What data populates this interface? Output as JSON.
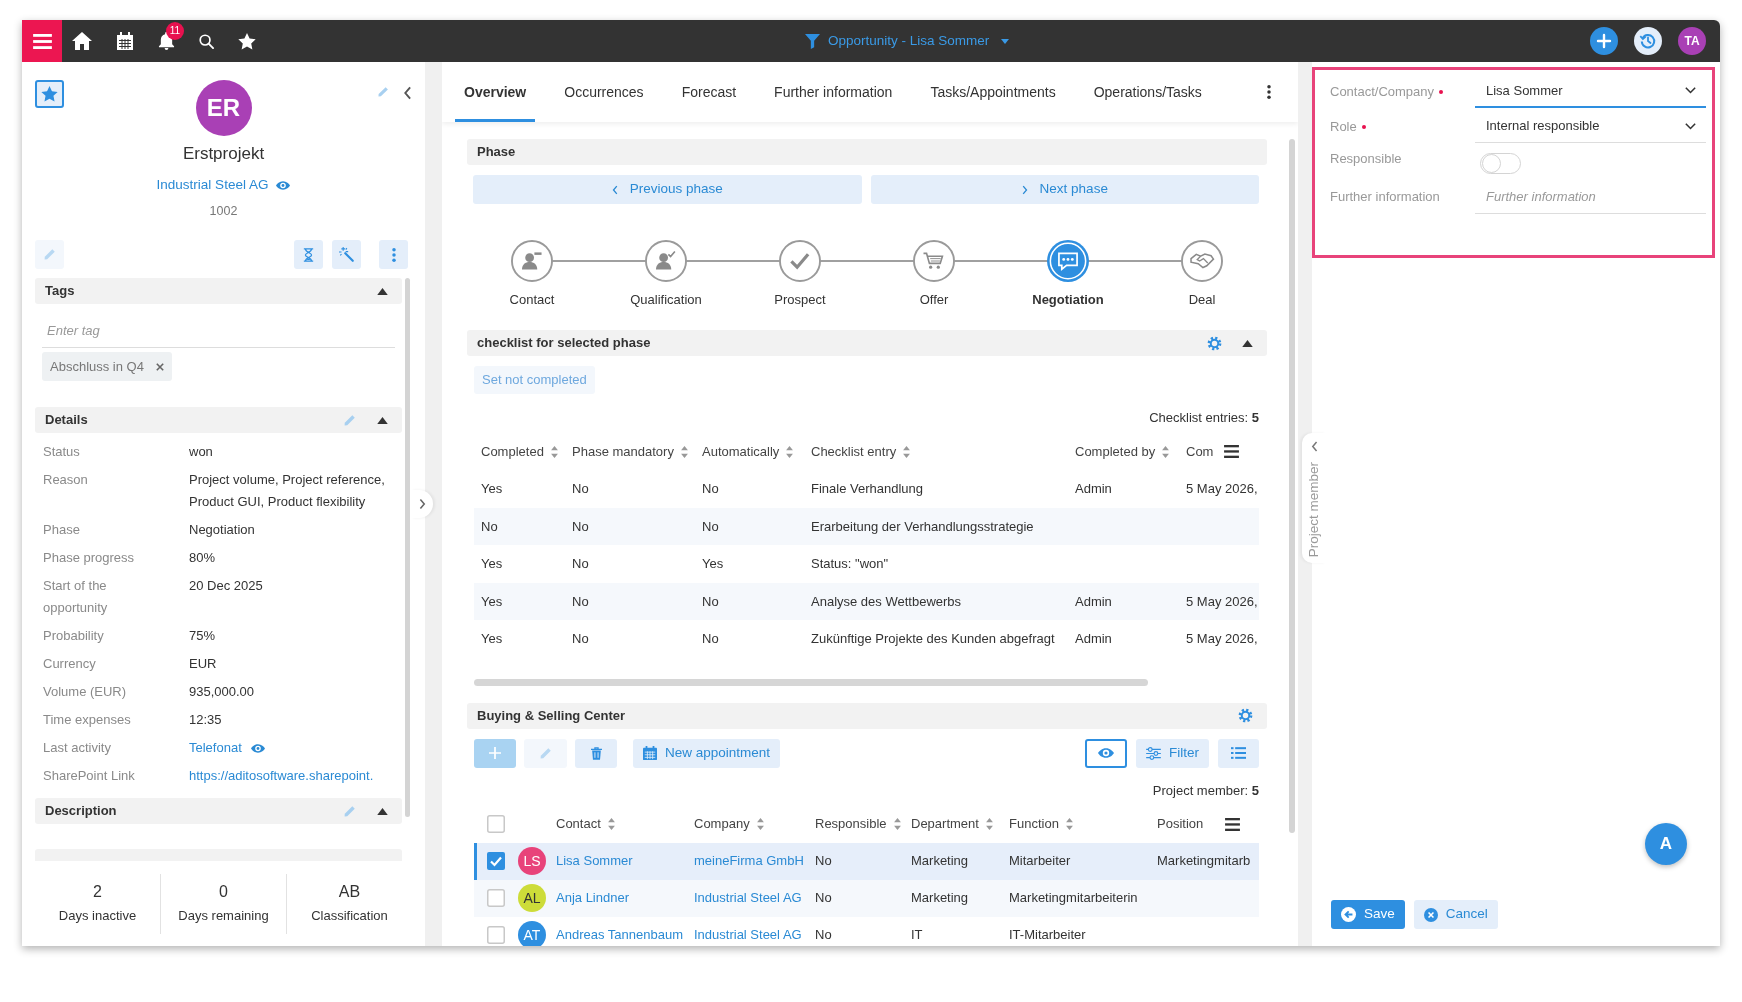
{
  "top_bar": {
    "notification_count": "11",
    "title": "Opportunity - Lisa Sommer",
    "user_initials": "TA"
  },
  "record": {
    "favorite": true,
    "initials": "ER",
    "name": "Erstprojekt",
    "company": "Industrial Steel AG",
    "number": "1002"
  },
  "tags": {
    "title": "Tags",
    "expanded": true,
    "placeholder": "Enter tag",
    "items": [
      "Abschluss in Q4"
    ]
  },
  "details": {
    "title": "Details",
    "expanded": true,
    "editable": true,
    "fields": [
      {
        "kind": "text",
        "label": "Status",
        "value": "won"
      },
      {
        "kind": "text",
        "label": "Reason",
        "value": "Project volume, Project reference, Product GUI, Product flexibility"
      },
      {
        "kind": "text",
        "label": "Phase",
        "value": "Negotiation"
      },
      {
        "kind": "text",
        "label": "Phase progress",
        "value": "80%"
      },
      {
        "kind": "text",
        "label": "Start of the opportunity",
        "value": "20 Dec 2025"
      },
      {
        "kind": "text",
        "label": "Probability",
        "value": "75%"
      },
      {
        "kind": "text",
        "label": "Currency",
        "value": "EUR"
      },
      {
        "kind": "text",
        "label": "Volume (EUR)",
        "value": "935,000.00"
      },
      {
        "kind": "text",
        "label": "Time expenses",
        "value": "12:35"
      },
      {
        "kind": "preview_link",
        "label": "Last activity",
        "value": "Telefonat"
      },
      {
        "kind": "link",
        "label": "SharePoint Link",
        "value": "https://aditosoftware.sharepoint."
      }
    ]
  },
  "description": {
    "title": "Description",
    "expanded": true,
    "editable": true
  },
  "stats": [
    {
      "value": "2",
      "label": "Days inactive"
    },
    {
      "value": "0",
      "label": "Days remaining"
    },
    {
      "value": "AB",
      "label": "Classification"
    }
  ],
  "tabs": [
    {
      "label": "Overview",
      "selected": true
    },
    {
      "label": "Occurrences",
      "selected": false
    },
    {
      "label": "Forecast",
      "selected": false
    },
    {
      "label": "Further information",
      "selected": false
    },
    {
      "label": "Tasks/Appointments",
      "selected": false
    },
    {
      "label": "Operations/Tasks",
      "selected": false
    }
  ],
  "phase": {
    "title": "Phase",
    "previous": "Previous phase",
    "next": "Next phase",
    "steps": [
      {
        "label": "Contact",
        "selected": false
      },
      {
        "label": "Qualification",
        "selected": false
      },
      {
        "label": "Prospect",
        "selected": false
      },
      {
        "label": "Offer",
        "selected": false
      },
      {
        "label": "Negotiation",
        "selected": true
      },
      {
        "label": "Deal",
        "selected": false
      }
    ]
  },
  "checklist": {
    "title": "checklist for selected phase",
    "expanded": true,
    "button": {
      "label": "Set not completed",
      "disabled": true
    },
    "count": "Checklist entries: **5**",
    "columns": [
      {
        "label": "Completed",
        "sortable": true
      },
      {
        "label": "Phase mandatory",
        "sortable": true
      },
      {
        "label": "Automatically",
        "sortable": true
      },
      {
        "label": "Checklist entry",
        "sortable": true
      },
      {
        "label": "Completed by",
        "sortable": true
      },
      {
        "label": "Com",
        "sortable": false
      }
    ],
    "rows": [
      {
        "completed": "Yes",
        "phase_mandatory": "No",
        "automatically": "No",
        "checklist_entry": "Finale Verhandlung",
        "completed_by": "Admin",
        "column_6": "5 May 2026,"
      },
      {
        "completed": "No",
        "phase_mandatory": "No",
        "automatically": "No",
        "checklist_entry": "Erarbeitung der Verhandlungsstrategie"
      },
      {
        "completed": "Yes",
        "phase_mandatory": "No",
        "automatically": "Yes",
        "checklist_entry": "Status: \"won\""
      },
      {
        "completed": "Yes",
        "phase_mandatory": "No",
        "automatically": "No",
        "checklist_entry": "Analyse des Wettbewerbs",
        "completed_by": "Admin",
        "column_6": "5 May 2026,"
      },
      {
        "completed": "Yes",
        "phase_mandatory": "No",
        "automatically": "No",
        "checklist_entry": "Zukünftige Projekte des Kunden abgefragt",
        "completed_by": "Admin",
        "column_6": "5 May 2026,"
      }
    ]
  },
  "buying_center": {
    "title": "Buying & Selling Center",
    "actions": [
      {
        "kind": "add",
        "disabled": true
      },
      {
        "kind": "edit",
        "disabled": true
      },
      {
        "kind": "delete",
        "disabled": false
      },
      {
        "kind": "appointment",
        "label": "New appointment",
        "disabled": false
      }
    ],
    "view_actions": [
      {
        "kind": "preview",
        "on": true
      },
      {
        "kind": "filter",
        "label": "Filter"
      },
      {
        "kind": "columns"
      }
    ],
    "count": "Project member: **5**",
    "header_checked": false,
    "columns": [
      {
        "label": "Contact",
        "sortable": true
      },
      {
        "label": "Company",
        "sortable": true
      },
      {
        "label": "Responsible",
        "sortable": true
      },
      {
        "label": "Department",
        "sortable": true
      },
      {
        "label": "Function",
        "sortable": true
      },
      {
        "label": "Position",
        "sortable": false
      }
    ],
    "rows": [
      {
        "selected": true,
        "initials": "LS",
        "color": "#e8437a",
        "contact": "Lisa Sommer",
        "company": "meineFirma GmbH",
        "responsible": "No",
        "department": "Marketing",
        "function": "Mitarbeiter",
        "position": "Marketingmitarb"
      },
      {
        "selected": false,
        "initials": "AL",
        "color": "#cddc39",
        "contact": "Anja Lindner",
        "company": "Industrial Steel AG",
        "responsible": "No",
        "department": "Marketing",
        "function": "Marketingmitarbeiterin"
      },
      {
        "selected": false,
        "initials": "AT",
        "color": "#2e8fe0",
        "contact": "Andreas Tannenbaum",
        "company": "Industrial Steel AG",
        "responsible": "No",
        "department": "IT",
        "function": "IT-Mitarbeiter"
      }
    ]
  },
  "member_form": {
    "fields": [
      {
        "kind": "select",
        "label": "Contact/Company",
        "required": true,
        "value": "Lisa Sommer",
        "focused": true
      },
      {
        "kind": "select",
        "label": "Role",
        "required": true,
        "value": "Internal responsible",
        "focused": false
      },
      {
        "kind": "toggle",
        "label": "Responsible",
        "on": false
      },
      {
        "kind": "text",
        "label": "Further information",
        "placeholder": "Further information"
      }
    ]
  },
  "side_tab": {
    "label": "Project member"
  },
  "assistant_button": {
    "label": "A"
  },
  "buttons": {
    "save": "Save",
    "cancel": "Cancel"
  }
}
